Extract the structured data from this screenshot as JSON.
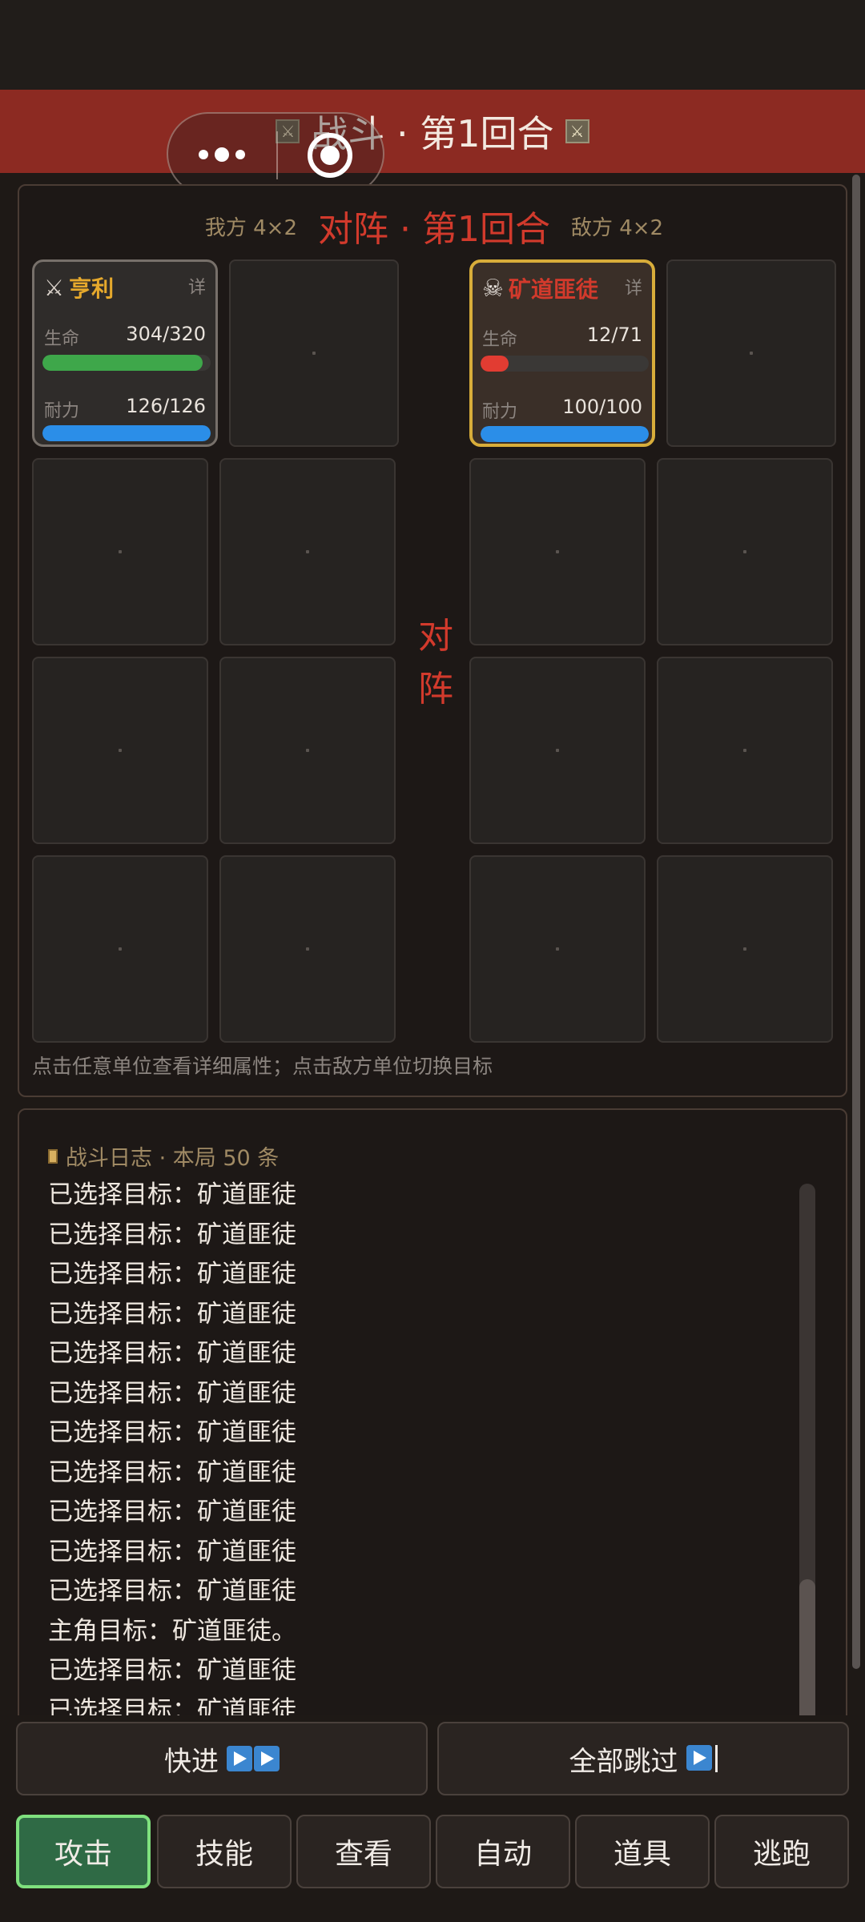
{
  "header": {
    "title": "战斗 · 第1回合"
  },
  "battle": {
    "ally_label": "我方 4×2",
    "center_title": "对阵 · 第1回合",
    "enemy_label": "敌方 4×2",
    "vs_line1": "对",
    "vs_line2": "阵",
    "hint": "点击任意单位查看详细属性；点击敌方单位切换目标",
    "ally_unit": {
      "name": "亨利",
      "detail": "详",
      "hp_label": "生命",
      "hp_text": "304/320",
      "hp_fraction": 0.95,
      "hp_color": "#3ea74a",
      "sta_label": "耐力",
      "sta_text": "126/126",
      "sta_fraction": 1.0,
      "sta_color": "#2b8ee8",
      "icon": "crossed-swords-icon"
    },
    "enemy_unit": {
      "name": "矿道匪徒",
      "detail": "详",
      "hp_label": "生命",
      "hp_text": "12/71",
      "hp_fraction": 0.169,
      "hp_color": "#e23c32",
      "sta_label": "耐力",
      "sta_text": "100/100",
      "sta_fraction": 1.0,
      "sta_color": "#2b8ee8",
      "icon": "skull-icon"
    }
  },
  "log": {
    "title": "战斗日志 · 本局 50 条",
    "lines": [
      "已选择目标：矿道匪徒",
      "已选择目标：矿道匪徒",
      "已选择目标：矿道匪徒",
      "已选择目标：矿道匪徒",
      "已选择目标：矿道匪徒",
      "已选择目标：矿道匪徒",
      "已选择目标：矿道匪徒",
      "已选择目标：矿道匪徒",
      "已选择目标：矿道匪徒",
      "已选择目标：矿道匪徒",
      "已选择目标：矿道匪徒",
      "主角目标：矿道匪徒。",
      "已选择目标：矿道匪徒",
      "已选择目标：矿道匪徒"
    ]
  },
  "footer": {
    "fast_forward": "快进",
    "skip_all": "全部跳过",
    "actions": [
      "攻击",
      "技能",
      "查看",
      "自动",
      "道具",
      "逃跑"
    ]
  },
  "colors": {
    "title_bar": "#8c2a22",
    "accent_red": "#d23a2c",
    "enemy_border": "#d8ad3a",
    "active_action": "#2f6a45"
  }
}
